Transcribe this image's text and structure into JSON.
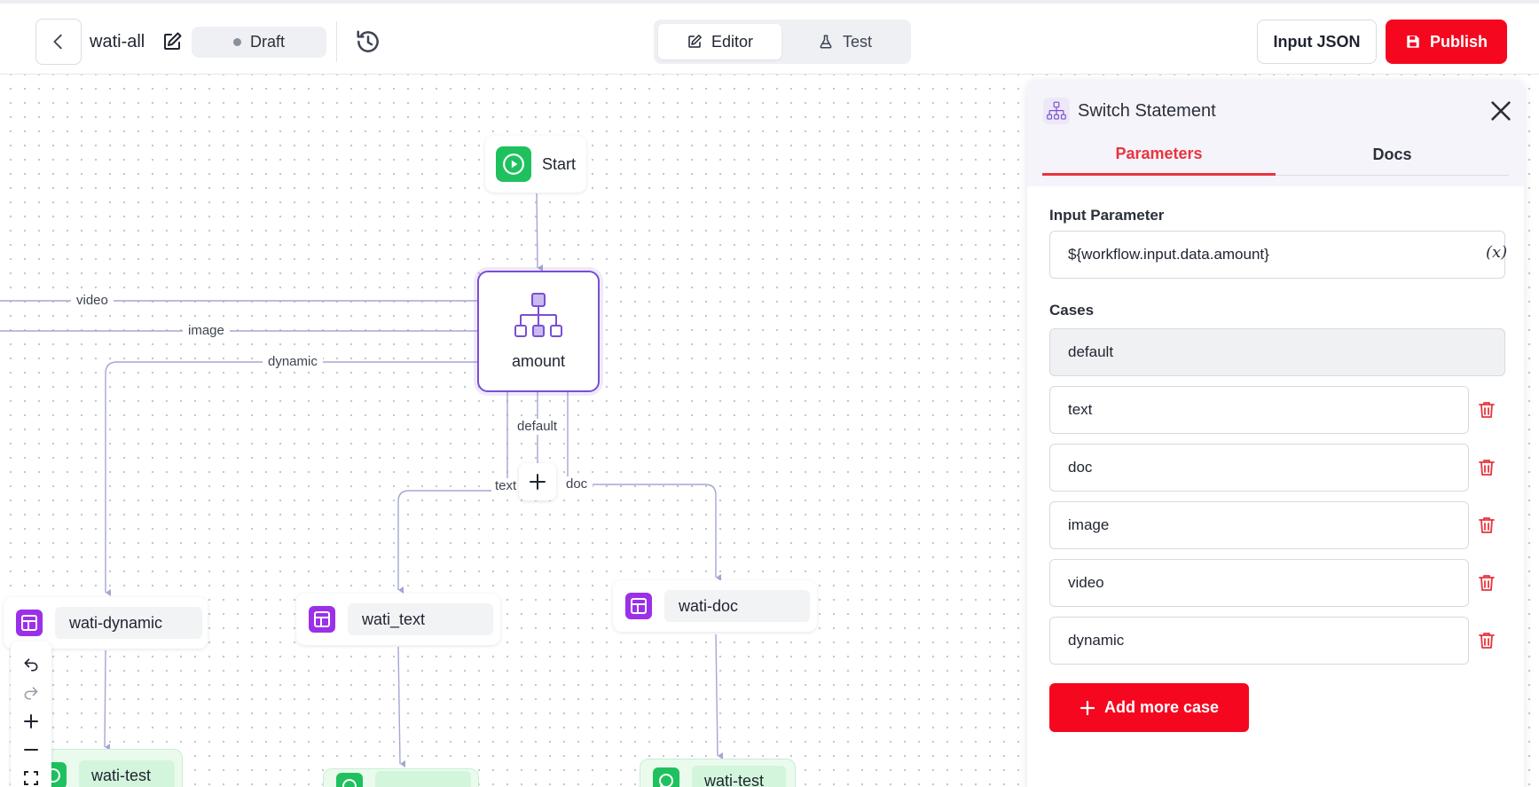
{
  "header": {
    "workflow_name": "wati-all",
    "status": "Draft",
    "tabs": {
      "editor": "Editor",
      "test": "Test"
    },
    "input_json_label": "Input JSON",
    "publish_label": "Publish"
  },
  "canvas": {
    "start_label": "Start",
    "switch_label": "amount",
    "edge_labels": {
      "video": "video",
      "image": "image",
      "dynamic": "dynamic",
      "default": "default",
      "text": "text",
      "doc": "doc"
    },
    "task_nodes": {
      "dynamic": "wati-dynamic",
      "text": "wati_text",
      "doc": "wati-doc"
    },
    "whatsapp_nodes": {
      "left": "wati-test",
      "middle": "",
      "right": "wati-test"
    }
  },
  "panel": {
    "title": "Switch Statement",
    "tabs": {
      "parameters": "Parameters",
      "docs": "Docs"
    },
    "input_parameter_label": "Input Parameter",
    "input_parameter_value": "${workflow.input.data.amount}",
    "variable_button": "(x)",
    "cases_label": "Cases",
    "default_case": "default",
    "cases": [
      "text",
      "doc",
      "image",
      "video",
      "dynamic"
    ],
    "add_case_label": "Add more case"
  },
  "colors": {
    "accent": "#f5071f",
    "switch_border": "#7a4fd1",
    "task_icon": "#9b30e8",
    "start_icon": "#1fc15e",
    "active_tab": "#e8343f"
  }
}
